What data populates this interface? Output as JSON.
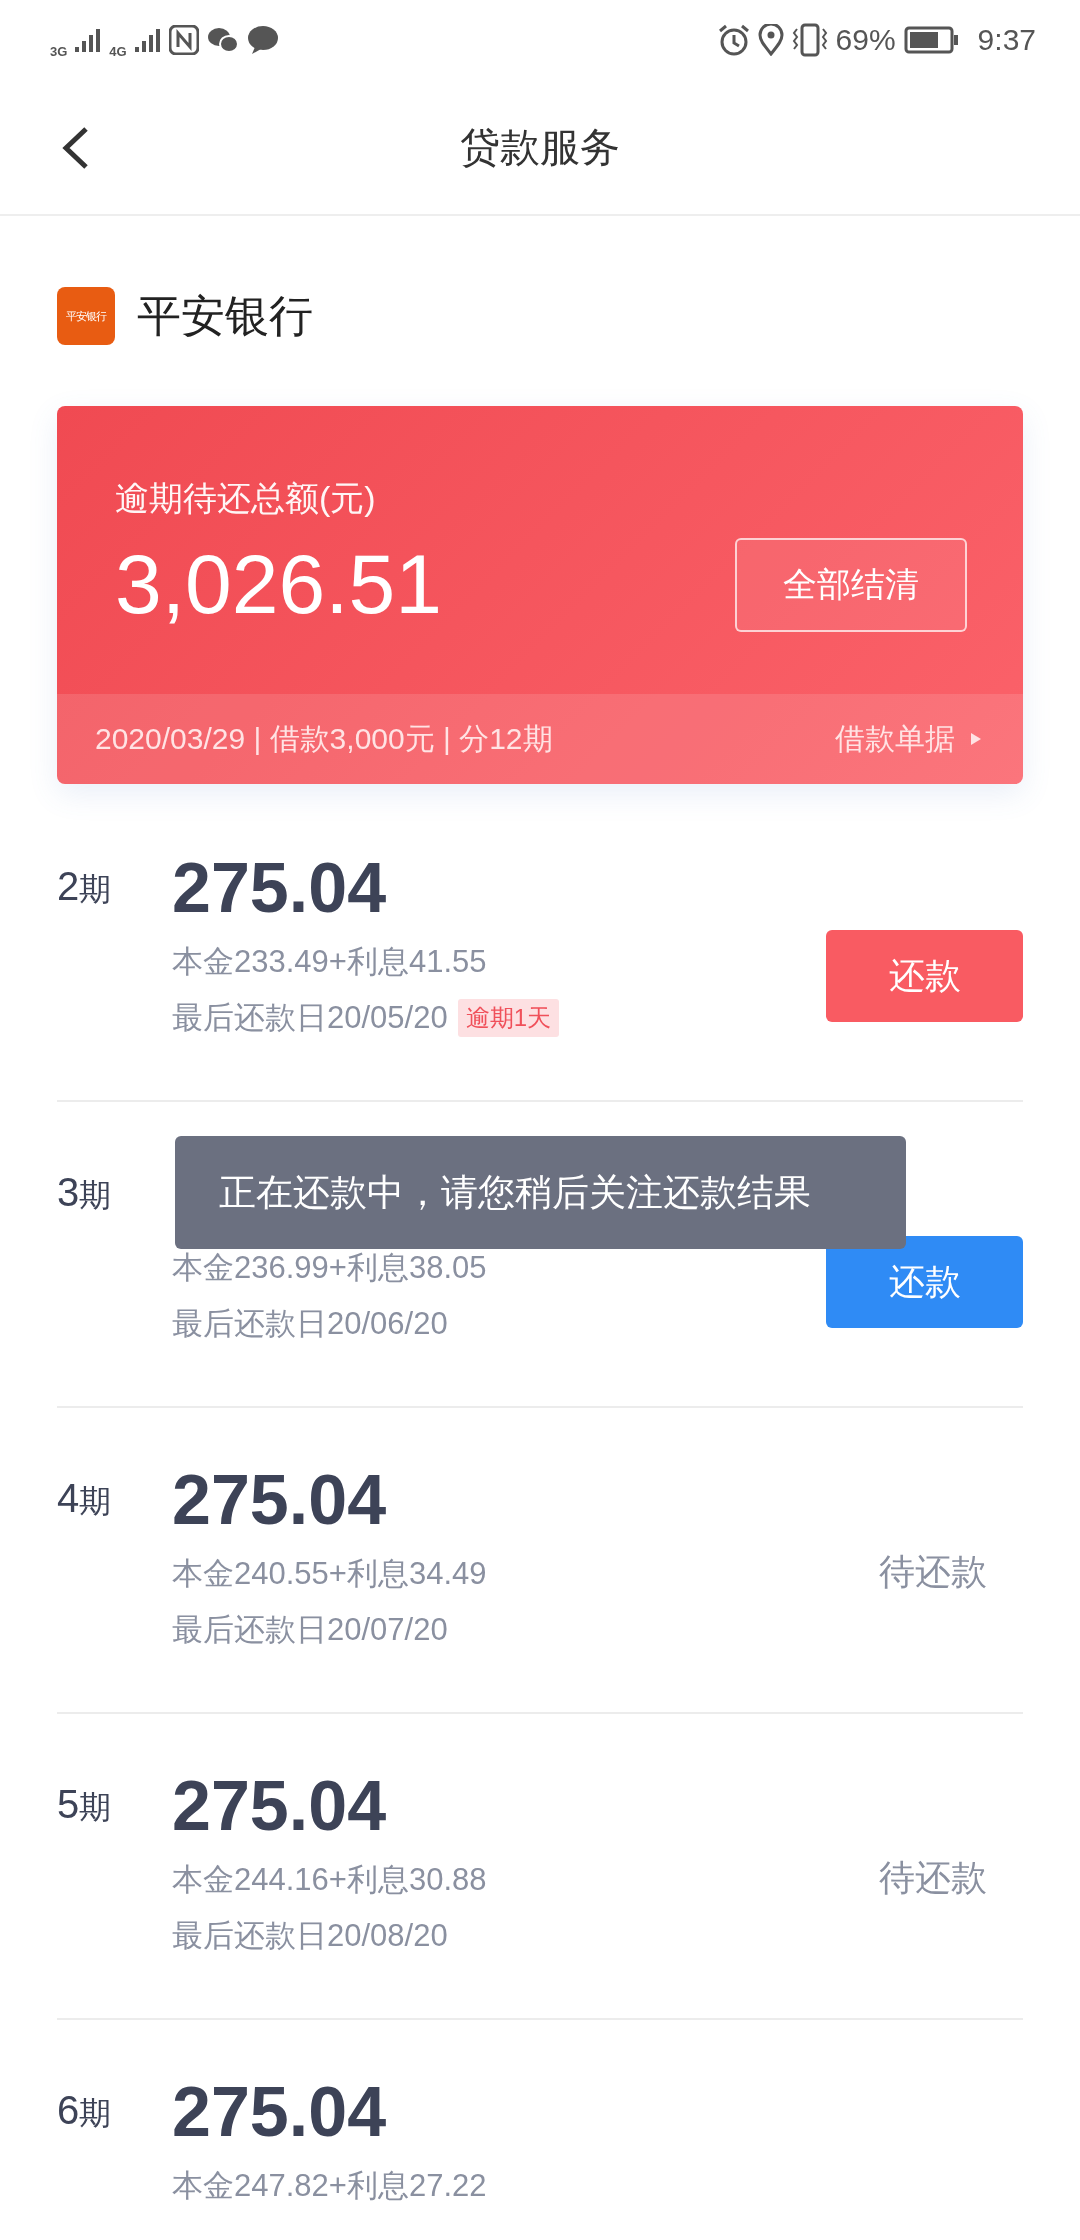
{
  "status_bar": {
    "network_1": "3G",
    "network_2": "4G",
    "battery_percent": "69%",
    "time": "9:37"
  },
  "header": {
    "title": "贷款服务"
  },
  "bank": {
    "logo_text": "平安银行",
    "name": "平安银行"
  },
  "summary": {
    "label": "逾期待还总额(元)",
    "amount": "3,026.51",
    "settle_button": "全部结清",
    "info": "2020/03/29 | 借款3,000元 | 分12期",
    "receipt_link": "借款单据"
  },
  "installments": [
    {
      "period": "2",
      "unit": "期",
      "amount": "275.04",
      "breakdown": "本金233.49+利息41.55",
      "due": "最后还款日20/05/20",
      "badge": "逾期1天",
      "kind": "pay",
      "overdue": true,
      "action": "还款"
    },
    {
      "period": "3",
      "unit": "期",
      "breakdown": "本金236.99+利息38.05",
      "due": "最后还款日20/06/20",
      "kind": "pay",
      "overdue": false,
      "action": "还款"
    },
    {
      "period": "4",
      "unit": "期",
      "amount": "275.04",
      "breakdown": "本金240.55+利息34.49",
      "due": "最后还款日20/07/20",
      "kind": "status",
      "action": "待还款"
    },
    {
      "period": "5",
      "unit": "期",
      "amount": "275.04",
      "breakdown": "本金244.16+利息30.88",
      "due": "最后还款日20/08/20",
      "kind": "status",
      "action": "待还款"
    },
    {
      "period": "6",
      "unit": "期",
      "amount": "275.04",
      "breakdown": "本金247.82+利息27.22",
      "kind": "none"
    }
  ],
  "toast": {
    "text": "正在还款中，请您稍后关注还款结果"
  }
}
